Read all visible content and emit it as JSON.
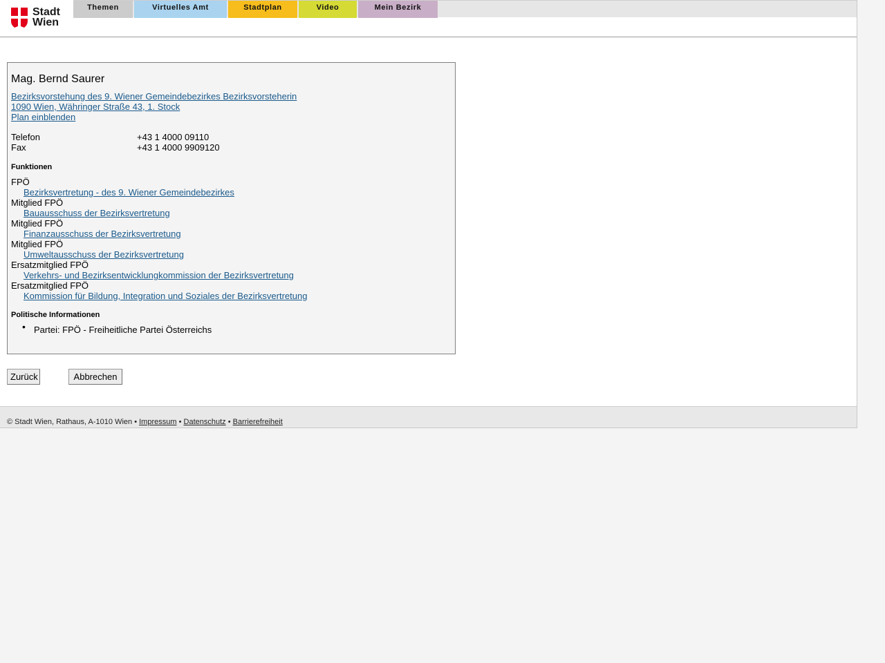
{
  "logo": {
    "line1": "Stadt",
    "line2": "Wien",
    "brand_color": "#e2001a"
  },
  "nav": {
    "tabs": [
      {
        "label": "Themen",
        "color": "#cccccc"
      },
      {
        "label": "Virtuelles Amt",
        "color": "#a9d3ef"
      },
      {
        "label": "Stadtplan",
        "color": "#f6bd1c"
      },
      {
        "label": "Video",
        "color": "#d5da34"
      },
      {
        "label": "Mein Bezirk",
        "color": "#c9aec7"
      }
    ]
  },
  "person": {
    "name": "Mag. Bernd Saurer",
    "office": "Bezirksvorstehung des 9. Wiener Gemeindebezirkes Bezirksvorsteherin",
    "address": "1090 Wien, Währinger Straße 43, 1. Stock",
    "plan_link": "Plan einblenden",
    "contacts": [
      {
        "label": "Telefon",
        "value": "+43 1 4000 09110"
      },
      {
        "label": "Fax",
        "value": "+43 1 4000 9909120"
      }
    ]
  },
  "functions": {
    "heading": "Funktionen",
    "items": [
      {
        "role": "FPÖ",
        "body": "Bezirksvertretung - des 9. Wiener Gemeindebezirkes"
      },
      {
        "role": "Mitglied FPÖ",
        "body": "Bauausschuss der Bezirksvertretung"
      },
      {
        "role": "Mitglied FPÖ",
        "body": "Finanzausschuss der Bezirksvertretung"
      },
      {
        "role": "Mitglied FPÖ",
        "body": "Umweltausschuss der Bezirksvertretung"
      },
      {
        "role": "Ersatzmitglied FPÖ",
        "body": "Verkehrs- und Bezirksentwicklungkommission der Bezirksvertretung"
      },
      {
        "role": "Ersatzmitglied FPÖ",
        "body": "Kommission für Bildung, Integration und Soziales der Bezirksvertretung"
      }
    ]
  },
  "political": {
    "heading": "Politische Informationen",
    "items": [
      "Partei: FPÖ - Freiheitliche Partei Österreichs"
    ]
  },
  "buttons": {
    "back": "Zurück",
    "cancel": "Abbrechen"
  },
  "footer": {
    "copyright": "© Stadt Wien, Rathaus, A-1010 Wien",
    "sep": "•",
    "links": [
      "Impressum",
      "Datenschutz",
      "Barrierefreiheit"
    ]
  },
  "colors": {
    "link": "#1a5a8c"
  }
}
